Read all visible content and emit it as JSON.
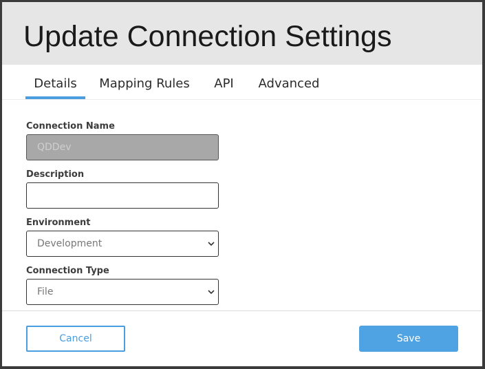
{
  "dialog": {
    "title": "Update Connection Settings"
  },
  "tabs": [
    {
      "label": "Details",
      "active": true
    },
    {
      "label": "Mapping Rules",
      "active": false
    },
    {
      "label": "API",
      "active": false
    },
    {
      "label": "Advanced",
      "active": false
    }
  ],
  "form": {
    "connection_name": {
      "label": "Connection Name",
      "value": "QDDev",
      "disabled": true
    },
    "description": {
      "label": "Description",
      "value": ""
    },
    "environment": {
      "label": "Environment",
      "selected": "Development"
    },
    "connection_type": {
      "label": "Connection Type",
      "selected": "File"
    }
  },
  "footer": {
    "cancel_label": "Cancel",
    "save_label": "Save"
  },
  "colors": {
    "accent": "#4a9ee0",
    "header_bg": "#e6e6e6",
    "disabled_field_bg": "#a8a8a8"
  },
  "icons": {
    "select_chevron": "chevron-down-icon"
  }
}
